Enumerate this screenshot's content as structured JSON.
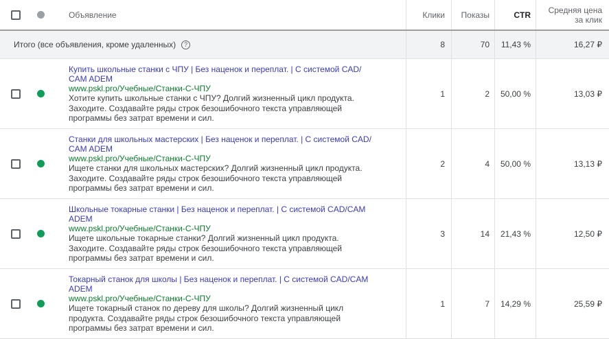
{
  "header": {
    "ad": "Объявление",
    "clicks": "Клики",
    "impressions": "Показы",
    "ctr": "CTR",
    "cpc_line1": "Средняя цена",
    "cpc_line2": "за клик"
  },
  "total": {
    "label": "Итого (все объявления, кроме удаленных)",
    "clicks": "8",
    "impressions": "70",
    "ctr": "11,43 %",
    "cpc": "16,27 ₽"
  },
  "ads": [
    {
      "title": "Купить школьные станки с ЧПУ | Без наценок и переплат. | С системой CAD/ CAM ADEM",
      "url": "www.pskl.pro/Учебные/Станки-С-ЧПУ",
      "description": "Хотите купить школьные станки с ЧПУ? Долгий жизненный цикл продукта. Заходите. Создавайте ряды строк безошибочного текста управляющей программы без затрат времени и сил.",
      "clicks": "1",
      "impressions": "2",
      "ctr": "50,00 %",
      "cpc": "13,03 ₽"
    },
    {
      "title": "Станки для школьных мастерских | Без наценок и переплат. | С системой CAD/ CAM ADEM",
      "url": "www.pskl.pro/Учебные/Станки-С-ЧПУ",
      "description": "Ищете станки для школьных мастерских? Долгий жизненный цикл продукта. Заходите. Создавайте ряды строк безошибочного текста управляющей программы без затрат времени и сил.",
      "clicks": "2",
      "impressions": "4",
      "ctr": "50,00 %",
      "cpc": "13,13 ₽"
    },
    {
      "title": "Школьные токарные станки | Без наценок и переплат. | С системой CAD/CAM ADEM",
      "url": "www.pskl.pro/Учебные/Станки-С-ЧПУ",
      "description": "Ищете школьные токарные станки? Долгий жизненный цикл продукта. Заходите. Создавайте ряды строк безошибочного текста управляющей программы без затрат времени и сил.",
      "clicks": "3",
      "impressions": "14",
      "ctr": "21,43 %",
      "cpc": "12,50 ₽"
    },
    {
      "title": "Токарный станок для школы | Без наценок и переплат. | С системой CAD/CAM ADEM",
      "url": "www.pskl.pro/Учебные/Станки-С-ЧПУ",
      "description": "Ищете токарный станок по дереву для школы? Долгий жизненный цикл продукта. Создавайте ряды строк безошибочного текста управляющей программы без затрат времени и сил.",
      "clicks": "1",
      "impressions": "7",
      "ctr": "14,29 %",
      "cpc": "25,59 ₽"
    }
  ],
  "colors": {
    "title_link": "#3b3bb8",
    "url_green": "#0d7a2e",
    "status_enabled": "#0f9d58",
    "status_header": "#9aa0a6"
  }
}
